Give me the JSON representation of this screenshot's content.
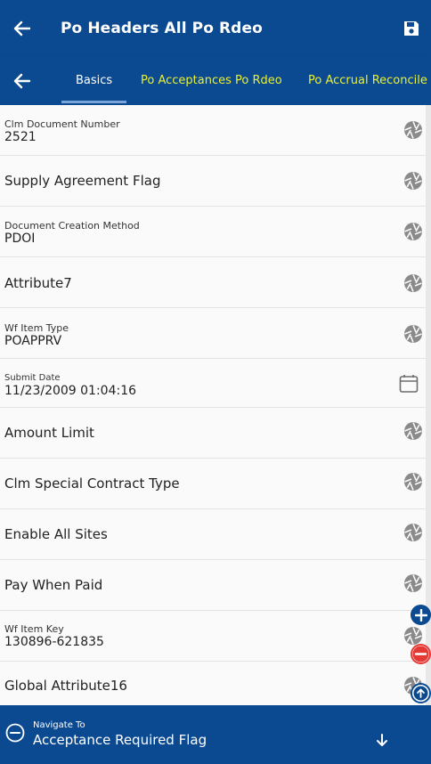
{
  "header": {
    "title": "Po Headers All Po Rdeo"
  },
  "tabs": [
    {
      "label": "Basics",
      "active": true
    },
    {
      "label": "Po Acceptances Po Rdeo",
      "active": false
    },
    {
      "label": "Po Accrual Reconcile",
      "active": false
    }
  ],
  "fields": [
    {
      "label": "Clm Document Number",
      "value": "2521",
      "icon": "aperture-icon"
    },
    {
      "label": "Supply Agreement Flag",
      "value": "",
      "icon": "aperture-icon"
    },
    {
      "label": "Document Creation Method",
      "value": "PDOI",
      "icon": "aperture-icon"
    },
    {
      "label": "Attribute7",
      "value": "",
      "icon": "aperture-icon"
    },
    {
      "label": "Wf Item Type",
      "value": "POAPPRV",
      "icon": "aperture-icon"
    },
    {
      "label": "Submit Date",
      "value": "11/23/2009 01:04:16",
      "icon": "calendar-icon"
    },
    {
      "label": "Amount Limit",
      "value": "",
      "icon": "aperture-icon"
    },
    {
      "label": "Clm Special Contract Type",
      "value": "",
      "icon": "aperture-icon"
    },
    {
      "label": "Enable All Sites",
      "value": "",
      "icon": "aperture-icon"
    },
    {
      "label": "Pay When Paid",
      "value": "",
      "icon": "aperture-icon"
    },
    {
      "label": "Wf Item Key",
      "value": "130896-621835",
      "icon": "aperture-icon"
    },
    {
      "label": "Global Attribute16",
      "value": "",
      "icon": "aperture-icon"
    }
  ],
  "bottom": {
    "label": "Navigate To",
    "value": "Acceptance Required Flag"
  },
  "colors": {
    "primary": "#0b4a91",
    "tab_inactive": "#e9f033",
    "fab_add": "#0b4a91",
    "fab_remove": "#e53935"
  }
}
